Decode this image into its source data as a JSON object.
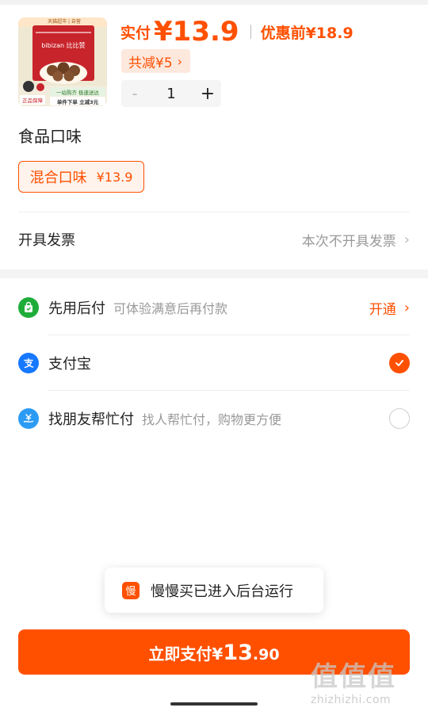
{
  "product": {
    "price_label": "实付",
    "price": "¥13.9",
    "original_price": "优惠前¥18.9",
    "discount": "共减¥5",
    "quantity_minus": "-",
    "quantity": "1",
    "quantity_plus": "+",
    "thumbnail": {
      "store_banner": "天猫超市 | 自营",
      "brand": "bibizan 比比赞",
      "badge_left": "正品保障",
      "badge_right_top": "一站购齐 极速送达",
      "badge_right_bottom": "单件下单 立减3元"
    }
  },
  "flavor": {
    "section_title": "食品口味",
    "option_name": "混合口味",
    "option_price": "¥13.9"
  },
  "invoice": {
    "label": "开具发票",
    "value": "本次不开具发票"
  },
  "payments": [
    {
      "name": "先用后付",
      "desc": "可体验满意后再付款",
      "action": "开通",
      "icon": "bag-check-icon",
      "color": "#1fad3a"
    },
    {
      "name": "支付宝",
      "desc": "",
      "selected": true,
      "icon": "alipay-icon",
      "color": "#1677ff"
    },
    {
      "name": "找朋友帮忙付",
      "desc": "找人帮忙付，购物更方便",
      "selected": false,
      "icon": "friend-pay-icon",
      "color": "#2b9bf4"
    }
  ],
  "toast": {
    "icon_text": "慢",
    "text": "慢慢买已进入后台运行"
  },
  "pay_button": {
    "label": "立即支付",
    "currency": "¥",
    "amount_int": "13",
    "amount_dec": ".90"
  },
  "watermark": {
    "glyphs": "值值值",
    "url": "zhizhizhi.com"
  },
  "colors": {
    "accent": "#ff5000"
  }
}
